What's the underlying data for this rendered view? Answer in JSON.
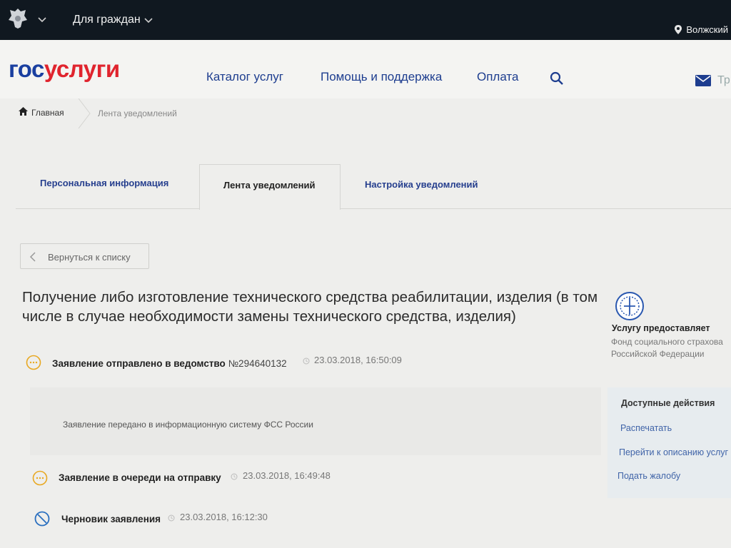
{
  "topbar": {
    "menu_label": "Для граждан",
    "region": "Волжский"
  },
  "header": {
    "logo_part1": "гос",
    "logo_part2": "услуги",
    "nav": [
      "Каталог услуг",
      "Помощь и поддержка",
      "Оплата"
    ],
    "mail_label": "Тр"
  },
  "breadcrumb": {
    "home": "Главная",
    "current": "Лента уведомлений"
  },
  "tabs": [
    {
      "label": "Персональная информация"
    },
    {
      "label": "Лента уведомлений"
    },
    {
      "label": "Настройка уведомлений"
    }
  ],
  "back_button": "Вернуться к списку",
  "title": "Получение либо изготовление технического средства реабилитации, изделия (в том числе в случае необходимости замены технического средства, изделия)",
  "statuses": [
    {
      "label": "Заявление отправлено в ведомство",
      "number": "№294640132",
      "time": "23.03.2018, 16:50:09"
    },
    {
      "label": "Заявление в очереди на отправку",
      "time": "23.03.2018, 16:49:48"
    },
    {
      "label": "Черновик заявления",
      "time": "23.03.2018, 16:12:30"
    }
  ],
  "detail_text": "Заявление передано в информационную систему ФСС России",
  "provider": {
    "heading": "Услугу предоставляет",
    "name_line1": "Фонд социального страхова",
    "name_line2": "Российской Федерации"
  },
  "actions": {
    "heading": "Доступные действия",
    "items": [
      "Распечатать",
      "Перейти к описанию услуг",
      "Подать жалобу"
    ]
  },
  "colors": {
    "brand_blue": "#1a3fa0",
    "brand_red": "#e0242e",
    "pending": "#e8a821",
    "draft": "#2a6fbf"
  }
}
